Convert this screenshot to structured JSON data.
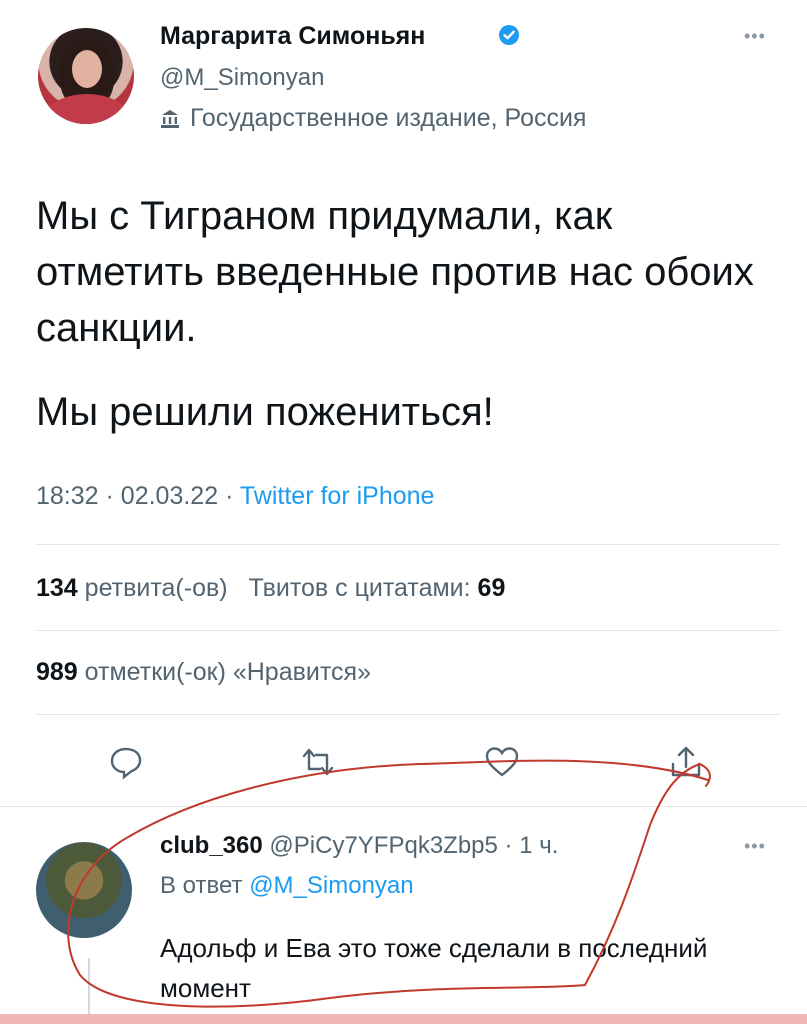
{
  "tweet": {
    "author_name": "Маргарита Симоньян",
    "author_handle": "@M_Simonyan",
    "label": "Государственное издание, Россия",
    "text_line1": "Мы с Тиграном придумали, как отметить введенные против нас обоих санкции.",
    "text_line2": "Мы решили пожениться!",
    "time": "18:32",
    "date": "02.03.22",
    "source": "Twitter for iPhone",
    "retweets_count": "134",
    "retweets_label": "ретвита(-ов)",
    "quotes_label": "Твитов с цитатами:",
    "quotes_count": "69",
    "likes_count": "989",
    "likes_label": "отметки(-ок) «Нравится»",
    "more_icon": "more-icon",
    "verified_icon": "verified-badge-icon",
    "label_icon": "government-building-icon"
  },
  "actions": [
    {
      "name": "reply",
      "icon": "reply-icon"
    },
    {
      "name": "retweet",
      "icon": "retweet-icon"
    },
    {
      "name": "like",
      "icon": "heart-icon"
    },
    {
      "name": "share",
      "icon": "share-icon"
    }
  ],
  "reply": {
    "author_name": "club_360",
    "author_handle": "@PiCy7YFPqk3Zbp5",
    "age": "1 ч.",
    "in_reply_prefix": "В ответ",
    "in_reply_handle": "@M_Simonyan",
    "text": "Адольф и Ева это тоже сделали в последний момент"
  },
  "colors": {
    "text": "#0f1419",
    "secondary": "#536471",
    "link": "#1d9bf0",
    "annotation": "#c0392b"
  }
}
